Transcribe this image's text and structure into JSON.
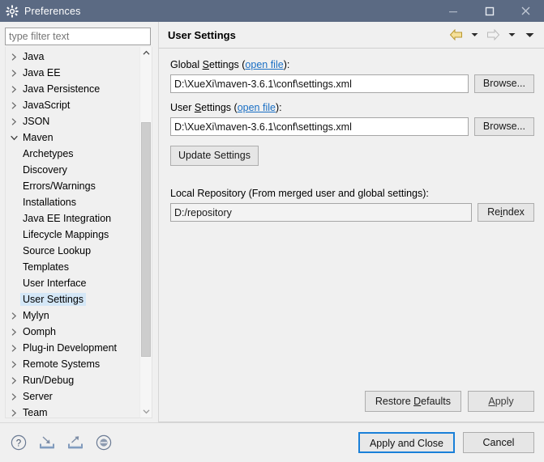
{
  "window": {
    "title": "Preferences",
    "icon": "gear-icon",
    "titlebar_color": "#5b6a83",
    "controls": {
      "minimize": "minimize-icon",
      "maximize": "maximize-icon",
      "close": "close-icon"
    }
  },
  "sidebar": {
    "filter": {
      "placeholder": "type filter text",
      "value": ""
    },
    "selected": "User Settings",
    "items": [
      {
        "label": "Java",
        "level": 0,
        "expandable": true,
        "expanded": false
      },
      {
        "label": "Java EE",
        "level": 0,
        "expandable": true,
        "expanded": false
      },
      {
        "label": "Java Persistence",
        "level": 0,
        "expandable": true,
        "expanded": false
      },
      {
        "label": "JavaScript",
        "level": 0,
        "expandable": true,
        "expanded": false
      },
      {
        "label": "JSON",
        "level": 0,
        "expandable": true,
        "expanded": false
      },
      {
        "label": "Maven",
        "level": 0,
        "expandable": true,
        "expanded": true
      },
      {
        "label": "Archetypes",
        "level": 1,
        "expandable": false,
        "expanded": false
      },
      {
        "label": "Discovery",
        "level": 1,
        "expandable": false,
        "expanded": false
      },
      {
        "label": "Errors/Warnings",
        "level": 1,
        "expandable": false,
        "expanded": false
      },
      {
        "label": "Installations",
        "level": 1,
        "expandable": false,
        "expanded": false
      },
      {
        "label": "Java EE Integration",
        "level": 1,
        "expandable": false,
        "expanded": false
      },
      {
        "label": "Lifecycle Mappings",
        "level": 1,
        "expandable": false,
        "expanded": false
      },
      {
        "label": "Source Lookup",
        "level": 1,
        "expandable": false,
        "expanded": false
      },
      {
        "label": "Templates",
        "level": 1,
        "expandable": false,
        "expanded": false
      },
      {
        "label": "User Interface",
        "level": 1,
        "expandable": false,
        "expanded": false
      },
      {
        "label": "User Settings",
        "level": 1,
        "expandable": false,
        "expanded": false
      },
      {
        "label": "Mylyn",
        "level": 0,
        "expandable": true,
        "expanded": false
      },
      {
        "label": "Oomph",
        "level": 0,
        "expandable": true,
        "expanded": false
      },
      {
        "label": "Plug-in Development",
        "level": 0,
        "expandable": true,
        "expanded": false
      },
      {
        "label": "Remote Systems",
        "level": 0,
        "expandable": true,
        "expanded": false
      },
      {
        "label": "Run/Debug",
        "level": 0,
        "expandable": true,
        "expanded": false
      },
      {
        "label": "Server",
        "level": 0,
        "expandable": true,
        "expanded": false
      },
      {
        "label": "Team",
        "level": 0,
        "expandable": true,
        "expanded": false
      }
    ],
    "scrollbar": {
      "up_icon": "chevron-up-icon",
      "down_icon": "chevron-down-icon"
    }
  },
  "page": {
    "title": "User Settings",
    "nav": {
      "back_icon": "back-arrow-icon",
      "back_menu_icon": "chevron-down-icon",
      "forward_icon": "forward-arrow-icon",
      "forward_menu_icon": "chevron-down-icon",
      "overflow_icon": "chevron-down-icon"
    },
    "global_settings": {
      "label_prefix": "Global ",
      "label_mnemonic": "S",
      "label_suffix": "ettings (",
      "link": "open file",
      "label_end": "):",
      "value": "D:\\XueXi\\maven-3.6.1\\conf\\settings.xml",
      "browse_label": "Browse..."
    },
    "user_settings": {
      "label_prefix": "User ",
      "label_mnemonic": "S",
      "label_suffix": "ettings (",
      "link": "open file",
      "label_end": "):",
      "value": "D:\\XueXi\\maven-3.6.1\\conf\\settings.xml",
      "browse_label": "Browse..."
    },
    "update_settings_label": "Update Settings",
    "local_repository": {
      "label": "Local Repository (From merged user and global settings):",
      "value": "D:/repository",
      "reindex_prefix": "Re",
      "reindex_mnemonic": "i",
      "reindex_suffix": "ndex"
    },
    "footer": {
      "restore_prefix": "Restore ",
      "restore_mnemonic": "D",
      "restore_suffix": "efaults",
      "apply_mnemonic": "A",
      "apply_suffix": "pply"
    }
  },
  "bottom_bar": {
    "icons": [
      {
        "name": "help-icon",
        "title": "Help"
      },
      {
        "name": "import-icon",
        "title": "Import"
      },
      {
        "name": "export-icon",
        "title": "Export"
      },
      {
        "name": "record-icon",
        "title": "Record"
      }
    ],
    "apply_and_close_label": "Apply and Close",
    "cancel_label": "Cancel",
    "default_button_accent": "#1a80d8"
  }
}
